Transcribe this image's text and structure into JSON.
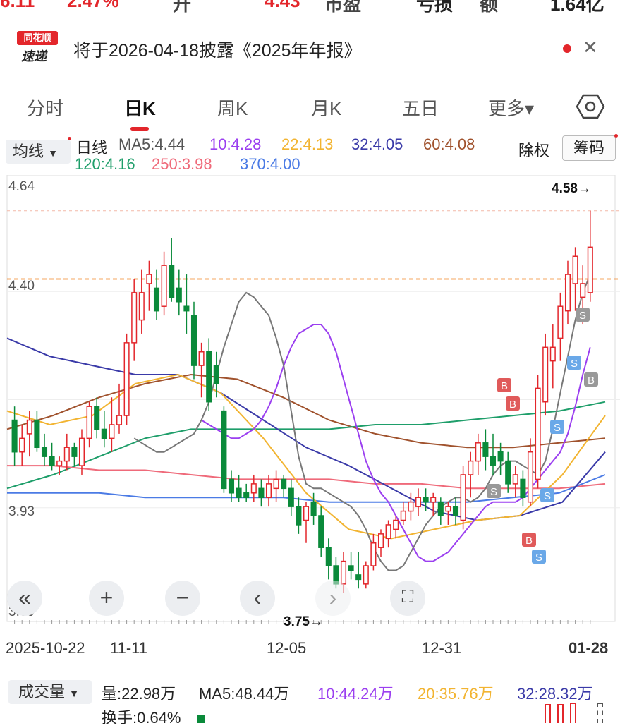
{
  "top_strip": {
    "v1": "6.11",
    "v2": "2.47%",
    "v3": "升",
    "v4": "4.43",
    "v5": "市盈",
    "v6": "亏损",
    "v7": "额",
    "v8": "1.64亿"
  },
  "notice": {
    "logo_top": "同花顺",
    "logo_bottom": "速递",
    "text": "将于2026-04-18披露《2025年年报》"
  },
  "tabs": [
    {
      "label": "分时"
    },
    {
      "label": "日K"
    },
    {
      "label": "周K"
    },
    {
      "label": "月K"
    },
    {
      "label": "五日"
    },
    {
      "label": "更多▾"
    }
  ],
  "toolbar": {
    "avg_label": "均线",
    "period": "日线",
    "ma": [
      {
        "text": "MA5:4.44",
        "color": "#555555"
      },
      {
        "text": "10:4.28",
        "color": "#9b3ff0"
      },
      {
        "text": "22:4.13",
        "color": "#f2b431"
      },
      {
        "text": "32:4.05",
        "color": "#3a3aa8"
      },
      {
        "text": "60:4.08",
        "color": "#a0522d"
      },
      {
        "text": "120:4.16",
        "color": "#1e9e6a"
      },
      {
        "text": "250:3.98",
        "color": "#ef6a7a"
      },
      {
        "text": "370:4.00",
        "color": "#4b7be5"
      }
    ],
    "chuquan": "除权",
    "chouma": "筹码"
  },
  "chart_data": {
    "type": "candlestick",
    "y_ticks": [
      "4.64",
      "4.40",
      "3.93",
      "3.69"
    ],
    "max_label": "4.58→",
    "min_label": "3.75→",
    "x_labels": [
      "2025-10-22",
      "11-11",
      "12-05",
      "12-31",
      "01-28"
    ],
    "ylim": [
      3.69,
      4.64
    ],
    "colors": {
      "up": "#e3262b",
      "down": "#0a8a3a"
    },
    "candles": [
      {
        "o": 4.12,
        "h": 4.15,
        "l": 4.02,
        "c": 4.05
      },
      {
        "o": 4.05,
        "h": 4.11,
        "l": 4.02,
        "c": 4.08
      },
      {
        "o": 4.09,
        "h": 4.14,
        "l": 4.04,
        "c": 4.12
      },
      {
        "o": 4.12,
        "h": 4.14,
        "l": 4.05,
        "c": 4.06
      },
      {
        "o": 4.06,
        "h": 4.09,
        "l": 4.02,
        "c": 4.04
      },
      {
        "o": 4.04,
        "h": 4.07,
        "l": 4.01,
        "c": 4.02
      },
      {
        "o": 4.02,
        "h": 4.04,
        "l": 4.0,
        "c": 4.03
      },
      {
        "o": 4.03,
        "h": 4.09,
        "l": 4.01,
        "c": 4.06
      },
      {
        "o": 4.06,
        "h": 4.07,
        "l": 4.02,
        "c": 4.04
      },
      {
        "o": 4.02,
        "h": 4.1,
        "l": 4.0,
        "c": 4.08
      },
      {
        "o": 4.08,
        "h": 4.16,
        "l": 4.06,
        "c": 4.15
      },
      {
        "o": 4.15,
        "h": 4.17,
        "l": 4.08,
        "c": 4.1
      },
      {
        "o": 4.1,
        "h": 4.14,
        "l": 4.06,
        "c": 4.08
      },
      {
        "o": 4.08,
        "h": 4.17,
        "l": 4.05,
        "c": 4.11
      },
      {
        "o": 4.11,
        "h": 4.2,
        "l": 4.09,
        "c": 4.13
      },
      {
        "o": 4.13,
        "h": 4.31,
        "l": 4.11,
        "c": 4.29
      },
      {
        "o": 4.29,
        "h": 4.43,
        "l": 4.25,
        "c": 4.4
      },
      {
        "o": 4.34,
        "h": 4.45,
        "l": 4.31,
        "c": 4.4
      },
      {
        "o": 4.42,
        "h": 4.47,
        "l": 4.36,
        "c": 4.44
      },
      {
        "o": 4.41,
        "h": 4.45,
        "l": 4.34,
        "c": 4.36
      },
      {
        "o": 4.37,
        "h": 4.49,
        "l": 4.35,
        "c": 4.46
      },
      {
        "o": 4.46,
        "h": 4.52,
        "l": 4.38,
        "c": 4.39
      },
      {
        "o": 4.41,
        "h": 4.45,
        "l": 4.35,
        "c": 4.38
      },
      {
        "o": 4.37,
        "h": 4.44,
        "l": 4.31,
        "c": 4.36
      },
      {
        "o": 4.35,
        "h": 4.38,
        "l": 4.21,
        "c": 4.24
      },
      {
        "o": 4.24,
        "h": 4.29,
        "l": 4.17,
        "c": 4.27
      },
      {
        "o": 4.27,
        "h": 4.3,
        "l": 4.14,
        "c": 4.16
      },
      {
        "o": 4.24,
        "h": 4.27,
        "l": 4.17,
        "c": 4.2
      },
      {
        "o": 4.14,
        "h": 4.15,
        "l": 3.96,
        "c": 3.97
      },
      {
        "o": 3.99,
        "h": 4.01,
        "l": 3.94,
        "c": 3.96
      },
      {
        "o": 3.97,
        "h": 4.0,
        "l": 3.94,
        "c": 3.95
      },
      {
        "o": 3.96,
        "h": 3.98,
        "l": 3.94,
        "c": 3.95
      },
      {
        "o": 3.96,
        "h": 4.0,
        "l": 3.94,
        "c": 3.98
      },
      {
        "o": 3.97,
        "h": 3.99,
        "l": 3.93,
        "c": 3.95
      },
      {
        "o": 3.95,
        "h": 4.0,
        "l": 3.93,
        "c": 3.98
      },
      {
        "o": 3.97,
        "h": 4.01,
        "l": 3.94,
        "c": 3.99
      },
      {
        "o": 3.99,
        "h": 4.0,
        "l": 3.95,
        "c": 3.97
      },
      {
        "o": 3.97,
        "h": 3.99,
        "l": 3.91,
        "c": 3.93
      },
      {
        "o": 3.93,
        "h": 3.95,
        "l": 3.87,
        "c": 3.89
      },
      {
        "o": 3.9,
        "h": 3.94,
        "l": 3.85,
        "c": 3.93
      },
      {
        "o": 3.94,
        "h": 3.96,
        "l": 3.89,
        "c": 3.91
      },
      {
        "o": 3.91,
        "h": 3.93,
        "l": 3.82,
        "c": 3.84
      },
      {
        "o": 3.84,
        "h": 3.86,
        "l": 3.77,
        "c": 3.8
      },
      {
        "o": 3.8,
        "h": 3.82,
        "l": 3.75,
        "c": 3.76
      },
      {
        "o": 3.76,
        "h": 3.83,
        "l": 3.74,
        "c": 3.81
      },
      {
        "o": 3.8,
        "h": 3.83,
        "l": 3.77,
        "c": 3.79
      },
      {
        "o": 3.78,
        "h": 3.83,
        "l": 3.75,
        "c": 3.77
      },
      {
        "o": 3.76,
        "h": 3.81,
        "l": 3.75,
        "c": 3.8
      },
      {
        "o": 3.8,
        "h": 3.87,
        "l": 3.79,
        "c": 3.85
      },
      {
        "o": 3.84,
        "h": 3.88,
        "l": 3.82,
        "c": 3.87
      },
      {
        "o": 3.86,
        "h": 3.9,
        "l": 3.84,
        "c": 3.89
      },
      {
        "o": 3.88,
        "h": 3.91,
        "l": 3.86,
        "c": 3.9
      },
      {
        "o": 3.9,
        "h": 3.94,
        "l": 3.89,
        "c": 3.92
      },
      {
        "o": 3.92,
        "h": 3.96,
        "l": 3.9,
        "c": 3.94
      },
      {
        "o": 3.93,
        "h": 3.97,
        "l": 3.91,
        "c": 3.95
      },
      {
        "o": 3.95,
        "h": 3.97,
        "l": 3.92,
        "c": 3.94
      },
      {
        "o": 3.94,
        "h": 3.96,
        "l": 3.91,
        "c": 3.95
      },
      {
        "o": 3.94,
        "h": 3.95,
        "l": 3.89,
        "c": 3.91
      },
      {
        "o": 3.92,
        "h": 3.94,
        "l": 3.89,
        "c": 3.93
      },
      {
        "o": 3.93,
        "h": 3.95,
        "l": 3.89,
        "c": 3.91
      },
      {
        "o": 3.9,
        "h": 4.02,
        "l": 3.88,
        "c": 4.0
      },
      {
        "o": 4.0,
        "h": 4.05,
        "l": 3.95,
        "c": 4.03
      },
      {
        "o": 4.03,
        "h": 4.09,
        "l": 4.0,
        "c": 4.07
      },
      {
        "o": 4.07,
        "h": 4.1,
        "l": 4.01,
        "c": 4.04
      },
      {
        "o": 4.04,
        "h": 4.09,
        "l": 4.0,
        "c": 4.02
      },
      {
        "o": 4.05,
        "h": 4.07,
        "l": 4.0,
        "c": 4.03
      },
      {
        "o": 4.03,
        "h": 4.05,
        "l": 3.96,
        "c": 3.98
      },
      {
        "o": 3.98,
        "h": 4.02,
        "l": 3.95,
        "c": 4.0
      },
      {
        "o": 3.99,
        "h": 4.01,
        "l": 3.93,
        "c": 3.95
      },
      {
        "o": 3.94,
        "h": 4.08,
        "l": 3.93,
        "c": 4.05
      },
      {
        "o": 3.99,
        "h": 4.22,
        "l": 3.97,
        "c": 4.19
      },
      {
        "o": 4.16,
        "h": 4.31,
        "l": 4.13,
        "c": 4.28
      },
      {
        "o": 4.25,
        "h": 4.33,
        "l": 4.19,
        "c": 4.28
      },
      {
        "o": 4.3,
        "h": 4.4,
        "l": 4.25,
        "c": 4.37
      },
      {
        "o": 4.36,
        "h": 4.47,
        "l": 4.33,
        "c": 4.44
      },
      {
        "o": 4.42,
        "h": 4.5,
        "l": 4.36,
        "c": 4.48
      },
      {
        "o": 4.39,
        "h": 4.46,
        "l": 4.33,
        "c": 4.42
      },
      {
        "o": 4.4,
        "h": 4.58,
        "l": 4.38,
        "c": 4.5
      }
    ],
    "ma_lines": [
      {
        "name": "MA5",
        "color": "#666666"
      },
      {
        "name": "MA10",
        "color": "#9b3ff0"
      },
      {
        "name": "MA22",
        "color": "#f2b431"
      },
      {
        "name": "MA32",
        "color": "#3a3aa8"
      },
      {
        "name": "MA60",
        "color": "#a0522d"
      },
      {
        "name": "MA120",
        "color": "#1e9e6a"
      },
      {
        "name": "MA250",
        "color": "#ef6a7a"
      },
      {
        "name": "MA370",
        "color": "#4b7be5"
      }
    ],
    "ma_points": {
      "MA5": [
        4.08,
        4.07,
        4.06,
        4.05,
        4.05,
        4.06,
        4.07,
        4.08,
        4.09,
        4.12,
        4.16,
        4.22,
        4.28,
        4.33,
        4.38,
        4.4,
        4.39,
        4.37,
        4.35,
        4.3,
        4.24,
        4.14,
        4.04,
        3.98,
        3.97,
        3.97,
        3.96,
        3.95,
        3.94,
        3.93,
        3.91,
        3.88,
        3.84,
        3.81,
        3.79,
        3.79,
        3.8,
        3.83,
        3.86,
        3.89,
        3.91,
        3.93,
        3.94,
        3.95,
        3.95,
        3.94,
        3.95,
        3.97,
        4.0,
        4.02,
        4.03,
        4.03,
        4.02,
        4.01,
        4.0,
        4.03,
        4.1,
        4.18,
        4.26,
        4.34,
        4.4,
        4.44
      ],
      "MA10": [
        4.12,
        4.11,
        4.1,
        4.09,
        4.08,
        4.08,
        4.09,
        4.1,
        4.12,
        4.15,
        4.19,
        4.24,
        4.28,
        4.31,
        4.32,
        4.33,
        4.33,
        4.31,
        4.27,
        4.21,
        4.15,
        4.09,
        4.03,
        3.99,
        3.96,
        3.94,
        3.91,
        3.88,
        3.85,
        3.82,
        3.81,
        3.81,
        3.82,
        3.83,
        3.85,
        3.87,
        3.89,
        3.91,
        3.93,
        3.94,
        3.94,
        3.94,
        3.94,
        3.95,
        3.97,
        3.99,
        4.01,
        4.03,
        4.05,
        4.09,
        4.15,
        4.22,
        4.28
      ]
    },
    "trade_marks": [
      "B",
      "B",
      "S",
      "S",
      "B",
      "B",
      "S",
      "S",
      "B",
      "S"
    ]
  },
  "controls": {
    "first": "«",
    "zoom_in": "+",
    "zoom_out": "−",
    "prev": "‹",
    "next": "›",
    "fullscreen": "⛶"
  },
  "volume": {
    "label": "成交量",
    "liang": "量:22.98万",
    "ma5": "MA5:48.44万",
    "ma10": "10:44.24万",
    "ma20": "20:35.76万",
    "ma32": "32:28.32万",
    "huanshou": "换手:0.64%"
  }
}
